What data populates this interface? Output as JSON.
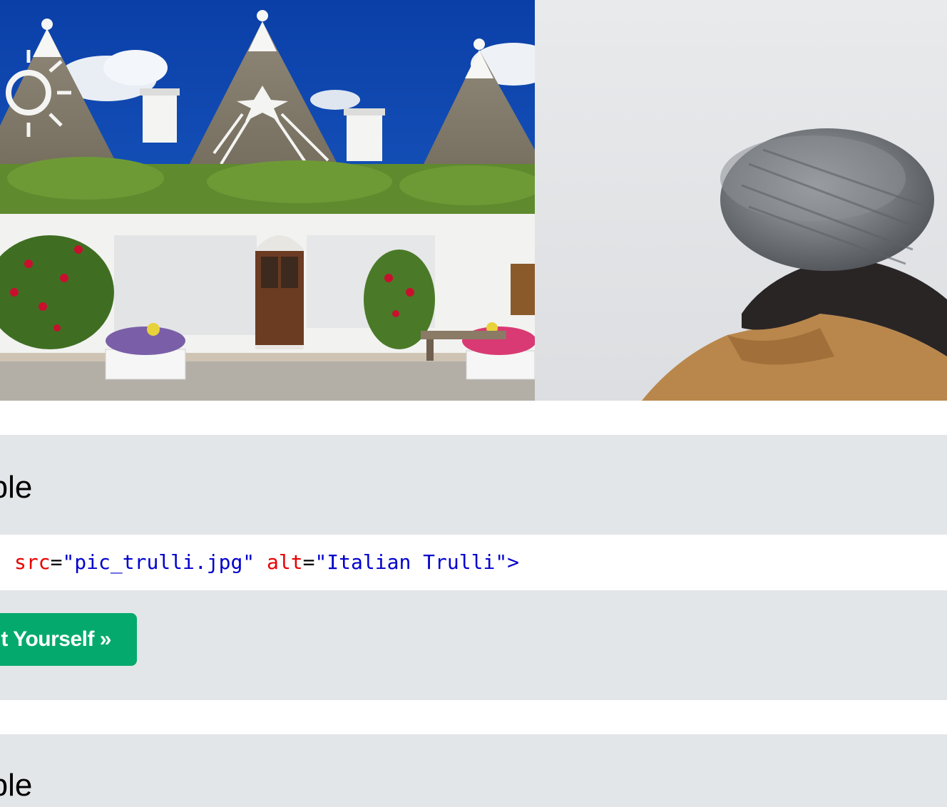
{
  "images": [
    {
      "subject": "trulli-houses-photo"
    },
    {
      "subject": "person-in-knit-beanie-photo"
    }
  ],
  "examples": [
    {
      "heading": "mple",
      "code": {
        "attr1": "src",
        "eq1": "=",
        "val1": "\"pic_trulli.jpg\"",
        "attr2": "alt",
        "eq2": "=",
        "val2": "\"Italian Trulli\"",
        "close": ">"
      },
      "button_label": "t Yourself »"
    },
    {
      "heading": "mple"
    }
  ],
  "colors": {
    "panel_bg": "#e3e6e8",
    "button_bg": "#04aa6d",
    "code_attr": "#e80000",
    "code_value": "#0000cd"
  }
}
